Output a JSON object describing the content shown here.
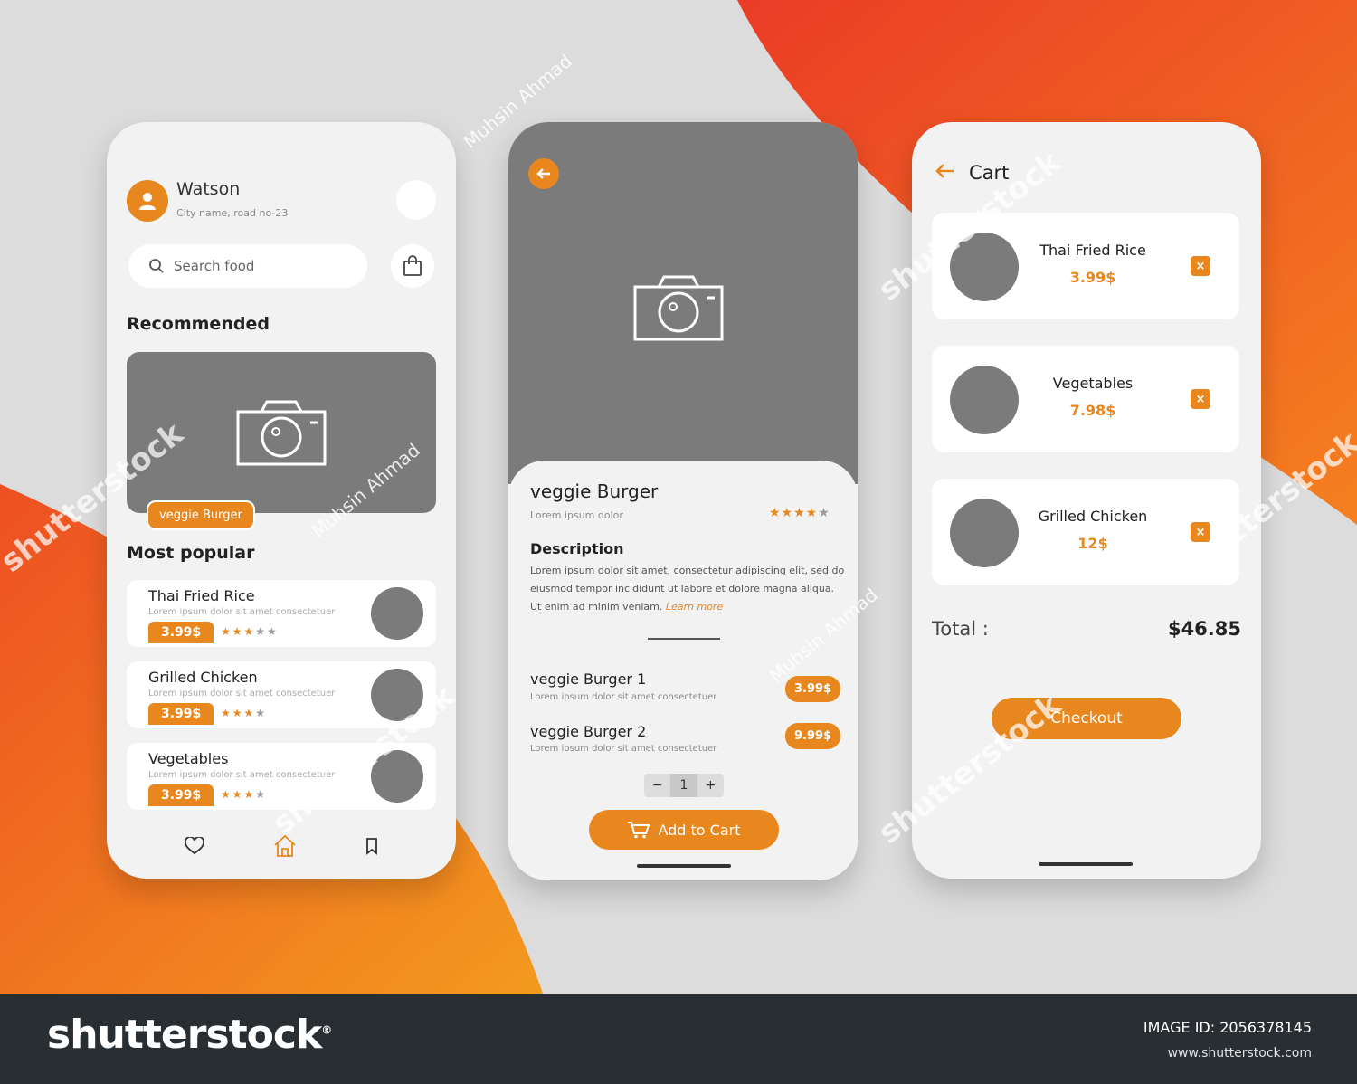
{
  "colors": {
    "accent": "#e8871e",
    "placeholder": "#7b7b7b",
    "background": "#dcdcdc",
    "footer": "#292e33"
  },
  "home": {
    "user": {
      "name": "Watson",
      "address": "City name, road no-23"
    },
    "search": {
      "placeholder": "Search food"
    },
    "recommended_title": "Recommended",
    "banner_tag": "veggie Burger",
    "popular_title": "Most popular",
    "popular": [
      {
        "name": "Thai Fried Rice",
        "desc": "Lorem ipsum dolor sit amet consectetuer",
        "price": "3.99$",
        "stars": 3
      },
      {
        "name": "Grilled Chicken",
        "desc": "Lorem ipsum dolor sit amet consectetuer",
        "price": "3.99$",
        "stars": 3
      },
      {
        "name": "Vegetables",
        "desc": "Lorem ipsum dolor sit amet consectetuer",
        "price": "3.99$",
        "stars": 3
      }
    ],
    "nav": [
      "heart-icon",
      "home-icon",
      "bookmark-icon"
    ]
  },
  "detail": {
    "title": "veggie Burger",
    "subtitle": "Lorem ipsum dolor",
    "rating": 4,
    "description_title": "Description",
    "description": "Lorem ipsum dolor sit amet, consectetur adipiscing elit, sed do eiusmod tempor incididunt ut labore et dolore magna aliqua. Ut enim ad minim veniam.",
    "learn_more": "Learn more",
    "variants": [
      {
        "name": "veggie Burger 1",
        "desc": "Lorem ipsum dolor sit amet consectetuer",
        "price": "3.99$"
      },
      {
        "name": "veggie Burger 2",
        "desc": "Lorem ipsum dolor sit amet consectetuer",
        "price": "9.99$"
      }
    ],
    "quantity": {
      "minus": "−",
      "value": "1",
      "plus": "+"
    },
    "add_to_cart": "Add to Cart"
  },
  "cart": {
    "title": "Cart",
    "items": [
      {
        "name": "Thai Fried Rice",
        "price": "3.99$",
        "remove": "×"
      },
      {
        "name": "Vegetables",
        "price": "7.98$",
        "remove": "×"
      },
      {
        "name": "Grilled Chicken",
        "price": "12$",
        "remove": "×"
      }
    ],
    "total_label": "Total :",
    "total_value": "$46.85",
    "checkout": "Checkout"
  },
  "watermark": {
    "brand": "shutterstock",
    "author": "Muhsin Ahmad"
  },
  "footer": {
    "brand": "shutterstock",
    "registered": "®",
    "image_id": "IMAGE ID: 2056378145",
    "site": "www.shutterstock.com"
  }
}
